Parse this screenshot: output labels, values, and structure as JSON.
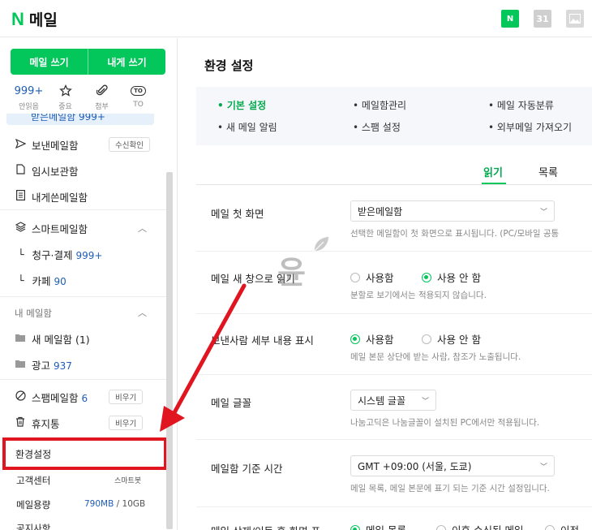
{
  "header": {
    "logo_letter": "N",
    "title": "메일",
    "icons": [
      "mail-app-icon",
      "calendar-icon",
      "photo-icon"
    ],
    "calendar_day": "31",
    "mail_icon_letter": "N"
  },
  "sidebar": {
    "write_mail": "메일 쓰기",
    "write_self": "내게 쓰기",
    "quick": [
      {
        "top": "999+",
        "label": "안읽음"
      },
      {
        "top": "☆",
        "label": "중요"
      },
      {
        "top": "📎",
        "label": "첨부"
      },
      {
        "top": "TO",
        "label": "TO"
      }
    ],
    "inbox_partial": "받은메일함 999+",
    "sent": "보낸메일함",
    "sent_pill": "수신확인",
    "drafts": "임시보관함",
    "self": "내게쓴메일함",
    "smart": "스마트메일함",
    "billing": "청구·결제",
    "billing_count": "999+",
    "cafe": "카페",
    "cafe_count": "90",
    "my_mailbox": "내 메일함",
    "new_mailbox": "새 메일함 (1)",
    "ads": "광고",
    "ads_count": "937",
    "spam": "스팸메일함",
    "spam_count": "6",
    "spam_pill": "비우기",
    "trash": "휴지통",
    "trash_pill": "비우기",
    "settings": "환경설정",
    "support": "고객센터",
    "support_pill": "스마트봇",
    "quota_label": "메일용량",
    "quota_used": "790MB",
    "quota_total": "/  10GB",
    "notice": "공지사항"
  },
  "main": {
    "title": "환경 설정",
    "menu": {
      "basic": "• 기본 설정",
      "manage": "• 메일함관리",
      "auto": "• 메일 자동분류",
      "alert": "• 새 메일 알림",
      "spam": "• 스팸 설정",
      "external": "• 외부메일 가져오기"
    },
    "tabs": {
      "read": "읽기",
      "list": "목록"
    },
    "rows": {
      "first_screen": {
        "label": "메일 첫 화면",
        "value": "받은메일함",
        "desc": "선택한 메일함이 첫 화면으로 표시됩니다. (PC/모바일 공통"
      },
      "new_window": {
        "label": "메일 새 창으로 읽기",
        "opt_on": "사용함",
        "opt_off": "사용 안 함",
        "desc": "분할로 보기에서는 적용되지 않습니다."
      },
      "sender_detail": {
        "label": "보낸사람 세부 내용 표시",
        "opt_on": "사용함",
        "opt_off": "사용 안 함",
        "desc": "메일 본문 상단에 받는 사람, 참조가 노출됩니다."
      },
      "font": {
        "label": "메일 글꼴",
        "value": "시스템 글꼴",
        "desc": "나눔고딕은 나눔글꼴이 설치된 PC에서만 적용됩니다."
      },
      "timezone": {
        "label": "메일함 기준 시간",
        "value": "GMT +09:00 (서울, 도쿄)",
        "desc": "메일 목록, 메일 본문에 표기 되는 기준 시간 설정입니다."
      },
      "after_action": {
        "label": "메일 삭제/이동 후 화면 표",
        "opt1": "메일 목록",
        "opt2": "이후 수신된 메일",
        "opt3": "이전"
      }
    }
  },
  "watermark": {
    "text": "윤"
  },
  "colors": {
    "brand": "#03c75a",
    "accent_blue": "#1f5db7",
    "highlight": "#e0151f"
  }
}
